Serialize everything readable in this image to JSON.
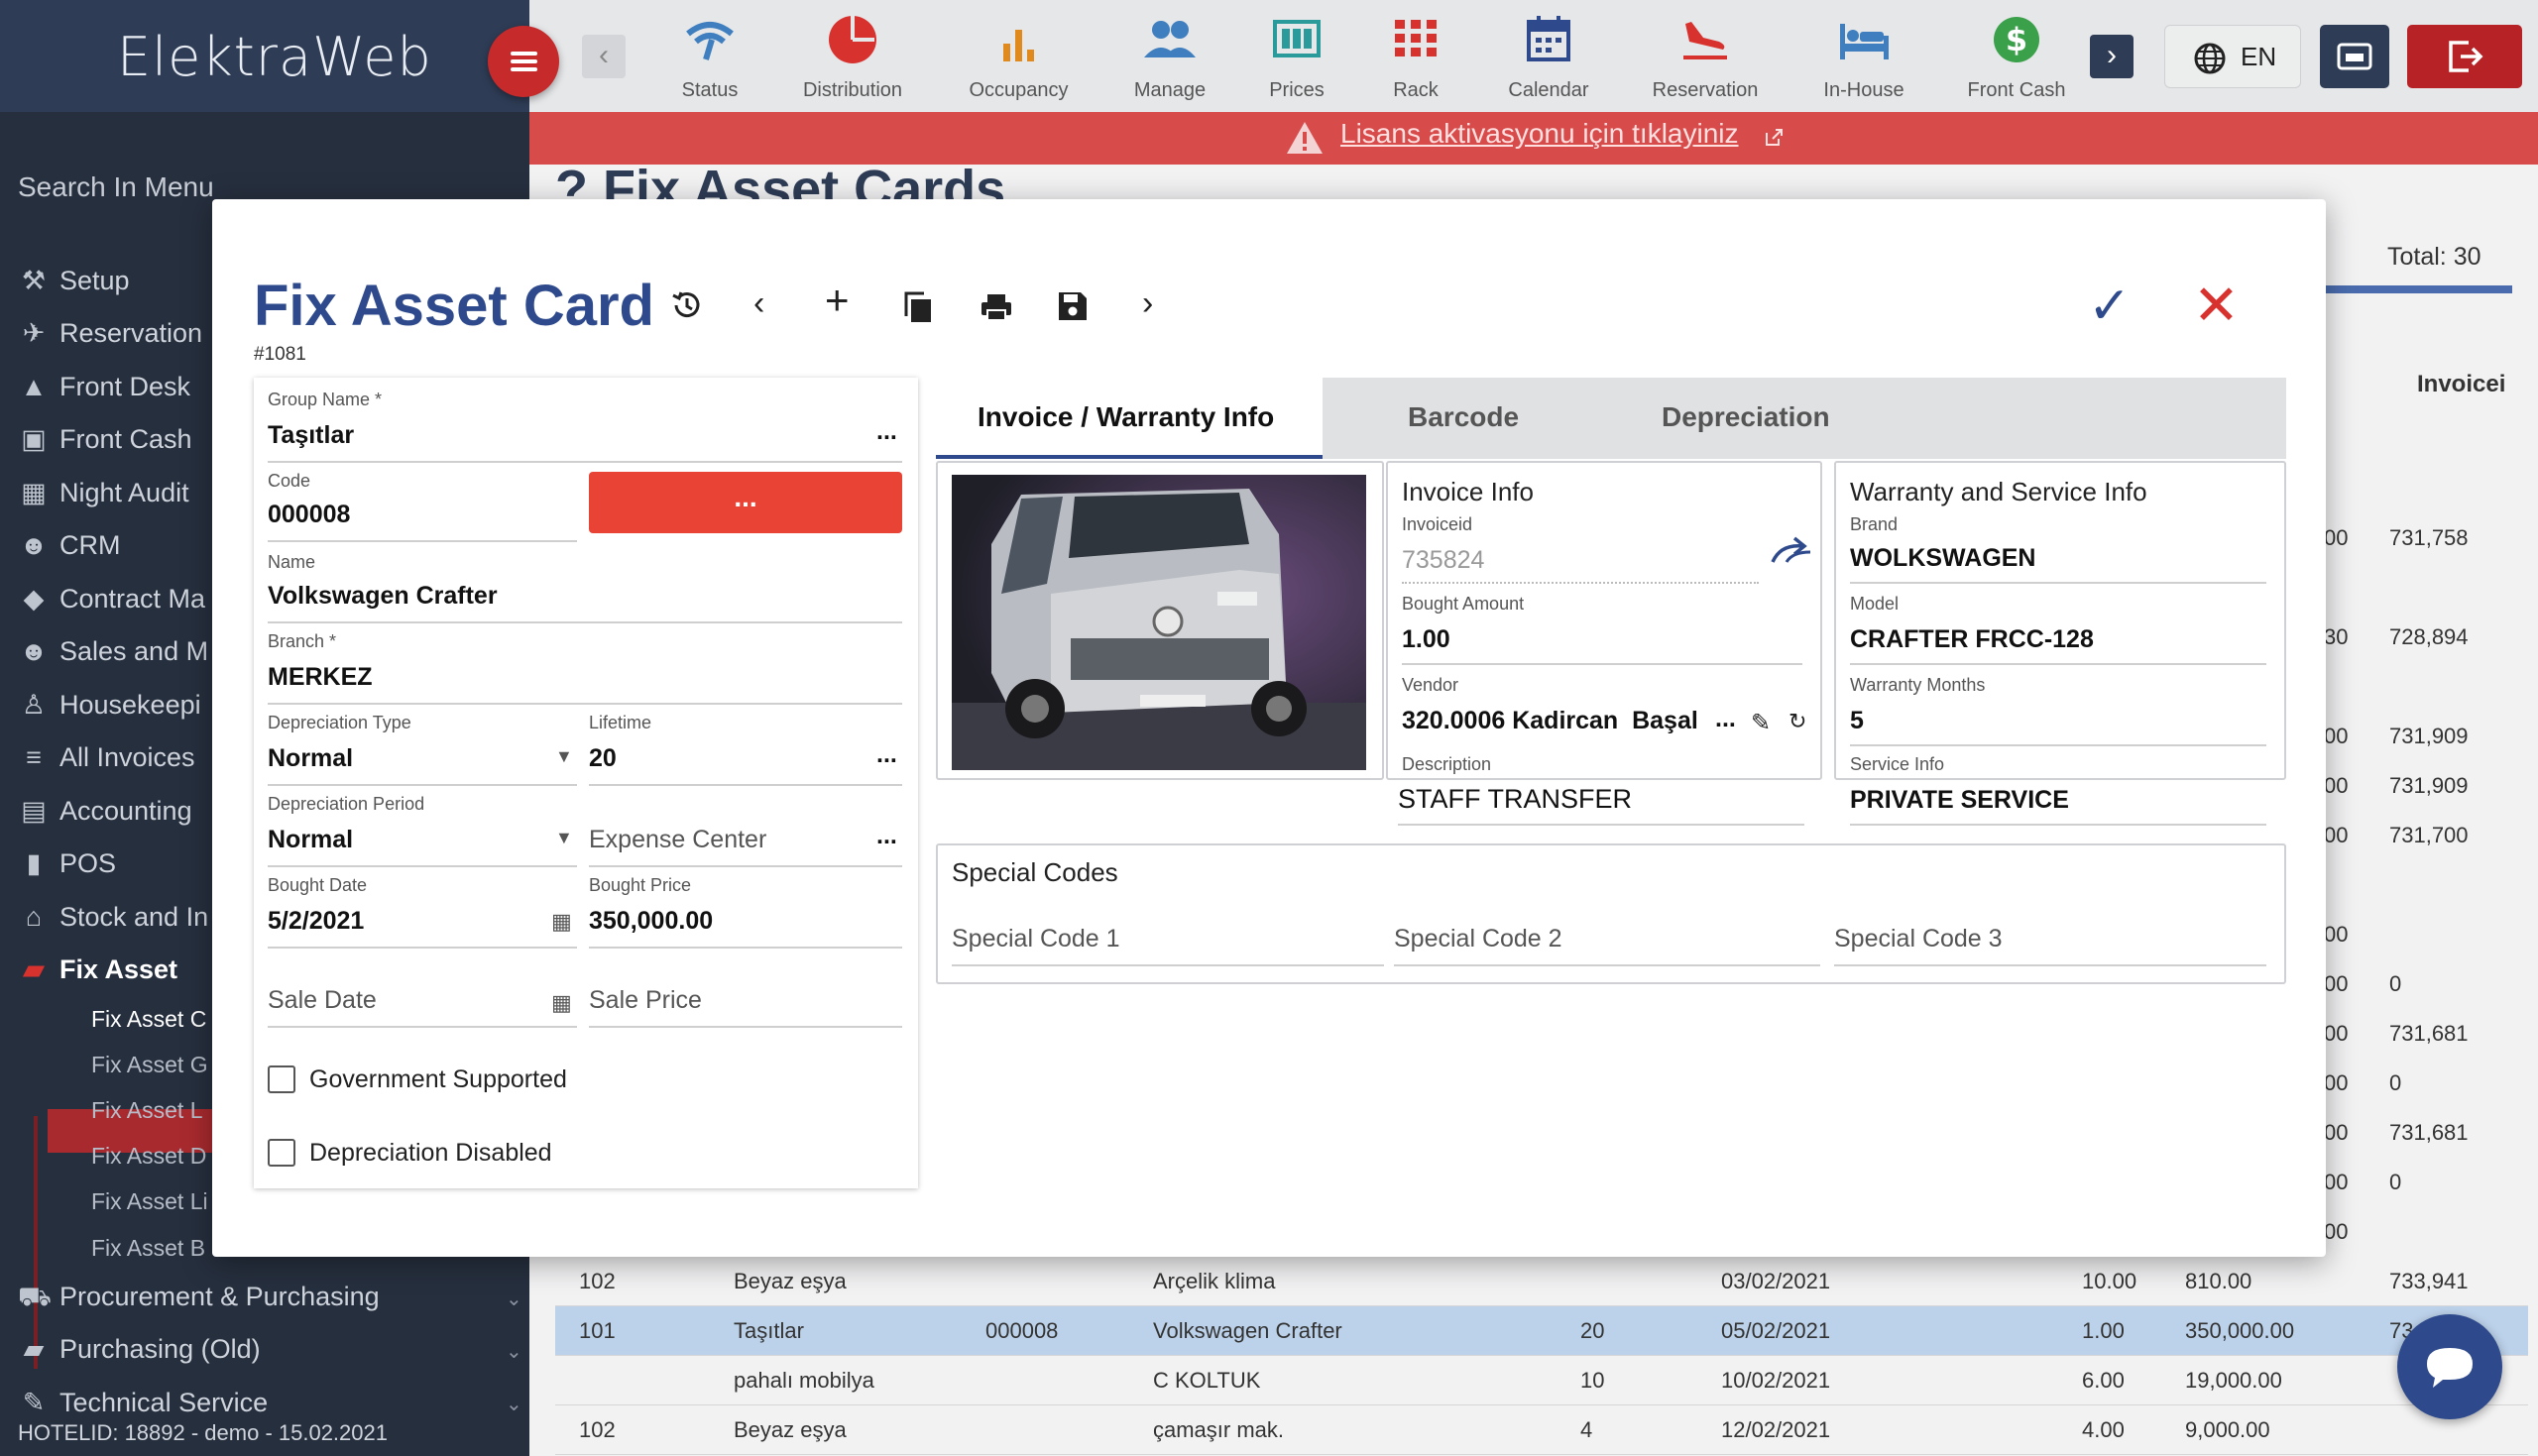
{
  "app": {
    "brand": "ElektraWeb"
  },
  "topnav": [
    {
      "label": "Status",
      "icon": "wifi-icon",
      "color": "#3f7fbf"
    },
    {
      "label": "Distribution",
      "icon": "pie-chart-icon",
      "color": "#d8322f"
    },
    {
      "label": "Occupancy",
      "icon": "bar-chart-icon",
      "color": "#e08a1e"
    },
    {
      "label": "Manage",
      "icon": "users-icon",
      "color": "#3f7fbf"
    },
    {
      "label": "Prices",
      "icon": "price-board-icon",
      "color": "#2a9a9a"
    },
    {
      "label": "Rack",
      "icon": "grid-icon",
      "color": "#d8322f"
    },
    {
      "label": "Calendar",
      "icon": "calendar-icon",
      "color": "#2e4a8c"
    },
    {
      "label": "Reservation",
      "icon": "plane-landing-icon",
      "color": "#d8322f"
    },
    {
      "label": "In-House",
      "icon": "bed-icon",
      "color": "#3f7fbf"
    },
    {
      "label": "Front Cash",
      "icon": "dollar-icon",
      "color": "#3aa04a"
    }
  ],
  "language": "EN",
  "license": {
    "text": "Lisans aktivasyonu için tıklayiniz"
  },
  "sidebar": {
    "search_placeholder": "Search In Menu",
    "items": [
      "Setup",
      "Reservation",
      "Front Desk",
      "Front Cash",
      "Night Audit",
      "CRM",
      "Contract Ma",
      "Sales and M",
      "Housekeepi",
      "All Invoices",
      "Accounting",
      "POS",
      "Stock and In",
      "Fix Asset"
    ],
    "subitems": [
      "Fix Asset C",
      "Fix Asset G",
      "Fix Asset L",
      "Fix Asset D",
      "Fix Asset Li",
      "Fix Asset B"
    ],
    "bottom_items": [
      "Procurement & Purchasing",
      "Purchasing (Old)",
      "Technical Service"
    ],
    "hotel_info": "HOTELID: 18892 - demo - 15.02.2021"
  },
  "background": {
    "page_title": "Fix Asset Cards",
    "total": "Total: 30",
    "col_invoice": "Invoicei",
    "right_values": [
      {
        "a": "00",
        "b": "731,758"
      },
      {
        "a": "30",
        "b": "728,894"
      },
      {
        "a": "00",
        "b": "731,909"
      },
      {
        "a": "00",
        "b": "731,909"
      },
      {
        "a": "00",
        "b": "731,700"
      },
      {
        "a": "00",
        "b": ""
      },
      {
        "a": "00",
        "b": "0"
      },
      {
        "a": "00",
        "b": "731,681"
      },
      {
        "a": "00",
        "b": "0"
      },
      {
        "a": "00",
        "b": "731,681"
      },
      {
        "a": "00",
        "b": "0"
      },
      {
        "a": "00",
        "b": ""
      }
    ],
    "rows": [
      {
        "c1": "102",
        "c2": "Beyaz eşya",
        "c3": "",
        "c4": "Arçelik klima",
        "c5": "",
        "c6": "03/02/2021",
        "c7": "10.00",
        "c8": "810.00",
        "c9": "733,941"
      },
      {
        "c1": "101",
        "c2": "Taşıtlar",
        "c3": "000008",
        "c4": "Volkswagen Crafter",
        "c5": "20",
        "c6": "05/02/2021",
        "c7": "1.00",
        "c8": "350,000.00",
        "c9": "73"
      },
      {
        "c1": "",
        "c2": "pahalı mobilya",
        "c3": "",
        "c4": "C KOLTUK",
        "c5": "10",
        "c6": "10/02/2021",
        "c7": "6.00",
        "c8": "19,000.00",
        "c9": ""
      },
      {
        "c1": "102",
        "c2": "Beyaz eşya",
        "c3": "",
        "c4": "çamaşır mak.",
        "c5": "4",
        "c6": "12/02/2021",
        "c7": "4.00",
        "c8": "9,000.00",
        "c9": ""
      }
    ]
  },
  "modal": {
    "title": "Fix Asset Card",
    "record_id": "#1081",
    "form": {
      "group_name_label": "Group Name *",
      "group_name": "Taşıtlar",
      "code_label": "Code",
      "code": "000008",
      "code_button": "...",
      "name_label": "Name",
      "name": "Volkswagen Crafter",
      "branch_label": "Branch *",
      "branch": "MERKEZ",
      "dep_type_label": "Depreciation Type",
      "dep_type": "Normal",
      "lifetime_label": "Lifetime",
      "lifetime": "20",
      "dep_period_label": "Depreciation Period",
      "dep_period": "Normal",
      "expense_center_placeholder": "Expense Center",
      "bought_date_label": "Bought Date",
      "bought_date": "5/2/2021",
      "bought_price_label": "Bought Price",
      "bought_price": "350,000.00",
      "sale_date_placeholder": "Sale Date",
      "sale_price_placeholder": "Sale Price",
      "gov_supported": "Government Supported",
      "dep_disabled": "Depreciation Disabled"
    },
    "tabs": [
      "Invoice / Warranty Info",
      "Barcode",
      "Depreciation"
    ],
    "invoice": {
      "heading": "Invoice Info",
      "invoiceid_label": "Invoiceid",
      "invoiceid": "735824",
      "bought_amount_label": "Bought Amount",
      "bought_amount": "1.00",
      "vendor_label": "Vendor",
      "vendor": "320.0006 Kadircan  Başal",
      "description_label": "Description",
      "description": "STAFF TRANSFER"
    },
    "warranty": {
      "heading": "Warranty and Service Info",
      "brand_label": "Brand",
      "brand": "WOLKSWAGEN",
      "model_label": "Model",
      "model": "CRAFTER FRCC-128",
      "months_label": "Warranty Months",
      "months": "5",
      "service_label": "Service Info",
      "service": "PRIVATE SERVICE"
    },
    "special_codes": {
      "heading": "Special Codes",
      "code1": "Special Code 1",
      "code2": "Special Code 2",
      "code3": "Special Code 3"
    }
  }
}
